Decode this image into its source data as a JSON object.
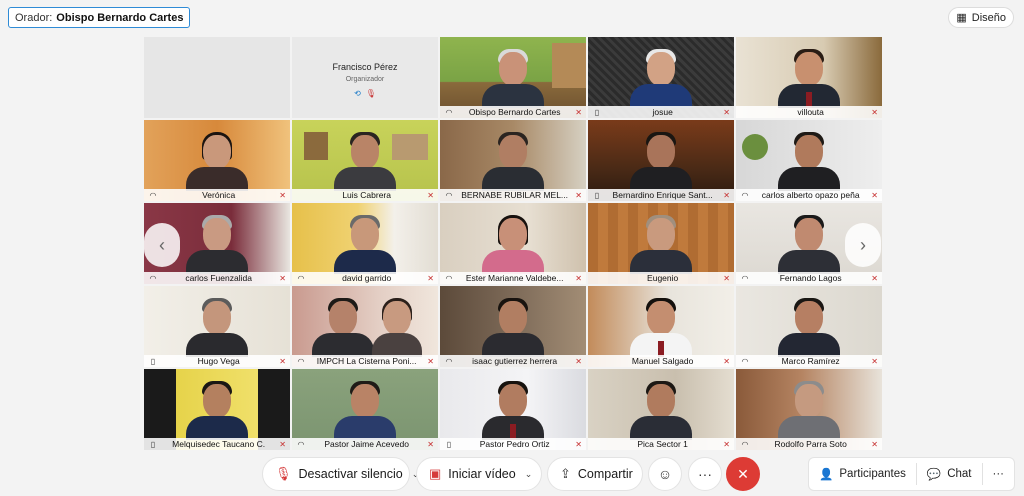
{
  "speaker": {
    "label": "Orador:",
    "name": "Obispo Bernardo Cartes"
  },
  "layout_button": {
    "label": "Diseño",
    "icon": "grid-layout-icon"
  },
  "placeholder": {
    "name": "Francisco Pérez",
    "role": "Organizador"
  },
  "participants": [
    {
      "name": "",
      "kind": "",
      "placeholder_empty": true
    },
    {
      "name": "Francisco Pérez",
      "kind": "",
      "placeholder": true
    },
    {
      "name": "Obispo Bernardo Cartes",
      "kind": "headset",
      "speaking": true
    },
    {
      "name": "josue",
      "kind": "phone"
    },
    {
      "name": "villouta",
      "kind": ""
    },
    {
      "name": "Verónica",
      "kind": "headset"
    },
    {
      "name": "Luis Cabrera",
      "kind": ""
    },
    {
      "name": "BERNABE RUBILAR MEL...",
      "kind": "headset"
    },
    {
      "name": "Bernardino Enrique Sant...",
      "kind": "phone"
    },
    {
      "name": "carlos alberto opazo peña",
      "kind": "headset"
    },
    {
      "name": "carlos Fuenzalida",
      "kind": "headset"
    },
    {
      "name": "david garrido",
      "kind": "headset"
    },
    {
      "name": "Ester Marianne Valdebe...",
      "kind": "headset"
    },
    {
      "name": "Eugenio",
      "kind": ""
    },
    {
      "name": "Fernando Lagos",
      "kind": "headset"
    },
    {
      "name": "Hugo Vega",
      "kind": "phone"
    },
    {
      "name": "IMPCH La Cisterna Poni...",
      "kind": "headset"
    },
    {
      "name": "isaac gutierrez herrera",
      "kind": "headset"
    },
    {
      "name": "Manuel Salgado",
      "kind": ""
    },
    {
      "name": "Marco Ramírez",
      "kind": "headset"
    },
    {
      "name": "Melquisedec Taucano C.",
      "kind": "phone"
    },
    {
      "name": "Pastor Jaime Acevedo",
      "kind": "headset"
    },
    {
      "name": "Pastor Pedro Ortiz",
      "kind": "phone"
    },
    {
      "name": "Pica Sector 1",
      "kind": ""
    },
    {
      "name": "Rodolfo Parra Soto",
      "kind": "headset"
    }
  ],
  "toolbar": {
    "mute": "Desactivar silencio",
    "video": "Iniciar vídeo",
    "share": "Compartir",
    "participants": "Participantes",
    "chat": "Chat"
  },
  "colors": {
    "accent": "#35b8e6",
    "end_call": "#dd3b35",
    "mic_muted": "#c62f2f"
  }
}
